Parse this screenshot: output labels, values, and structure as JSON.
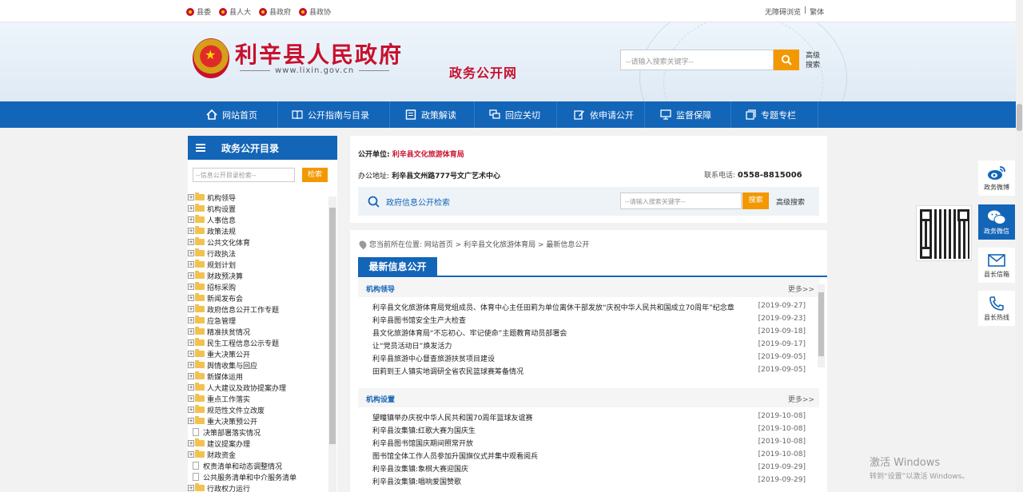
{
  "topbar": {
    "links": [
      "县委",
      "县人大",
      "县政府",
      "县政协"
    ],
    "accessibility": "无障碍浏览",
    "divider": "|",
    "traditional": "繁体"
  },
  "header": {
    "site_name": "利辛县人民政府",
    "site_url": "www.lixin.gov.cn",
    "sub_title": "政务公开网",
    "search_placeholder": "--请输入搜索关键字--",
    "advanced_search": "高级搜索"
  },
  "nav": {
    "items": [
      {
        "label": "网站首页",
        "icon": "home-icon"
      },
      {
        "label": "公开指南与目录",
        "icon": "book-icon"
      },
      {
        "label": "政策解读",
        "icon": "document-icon"
      },
      {
        "label": "回应关切",
        "icon": "chat-icon"
      },
      {
        "label": "依申请公开",
        "icon": "edit-icon"
      },
      {
        "label": "监督保障",
        "icon": "monitor-icon"
      },
      {
        "label": "专题专栏",
        "icon": "layers-icon"
      }
    ]
  },
  "sidebar": {
    "title": "政务公开目录",
    "search_placeholder": "--信息公开目录检索--",
    "search_button": "检索",
    "tree": [
      {
        "label": "机构领导",
        "type": "folder"
      },
      {
        "label": "机构设置",
        "type": "folder"
      },
      {
        "label": "人事信息",
        "type": "folder"
      },
      {
        "label": "政策法规",
        "type": "folder"
      },
      {
        "label": "公共文化体育",
        "type": "folder"
      },
      {
        "label": "行政执法",
        "type": "folder"
      },
      {
        "label": "规划计划",
        "type": "folder"
      },
      {
        "label": "财政预决算",
        "type": "folder"
      },
      {
        "label": "招标采购",
        "type": "folder"
      },
      {
        "label": "新闻发布会",
        "type": "folder"
      },
      {
        "label": "政府信息公开工作专题",
        "type": "folder"
      },
      {
        "label": "应急管理",
        "type": "folder"
      },
      {
        "label": "精准扶贫情况",
        "type": "folder"
      },
      {
        "label": "民生工程信息公示专题",
        "type": "folder"
      },
      {
        "label": "重大决策公开",
        "type": "folder"
      },
      {
        "label": "舆情收集与回应",
        "type": "folder"
      },
      {
        "label": "新媒体运用",
        "type": "folder"
      },
      {
        "label": "人大建议及政协提案办理",
        "type": "folder"
      },
      {
        "label": "重点工作落实",
        "type": "folder"
      },
      {
        "label": "规范性文件立改废",
        "type": "folder"
      },
      {
        "label": "重大决策预公开",
        "type": "folder"
      },
      {
        "label": "决策部署落实情况",
        "type": "doc"
      },
      {
        "label": "建议提案办理",
        "type": "folder"
      },
      {
        "label": "财政资金",
        "type": "folder"
      },
      {
        "label": "权责清单和动态调整情况",
        "type": "doc"
      },
      {
        "label": "公共服务清单和中介服务清单",
        "type": "doc"
      },
      {
        "label": "行政权力运行",
        "type": "folder"
      }
    ]
  },
  "infobox": {
    "unit_label": "公开单位:",
    "unit_value": "利辛县文化旅游体育局",
    "address_label": "办公地址:",
    "address_value": "利辛县文州路777号文广艺术中心",
    "tel_label": "联系电话:",
    "tel_value": "0558-8815006",
    "search_title": "政府信息公开检索",
    "search_placeholder": "--请输入搜索关键字--",
    "search_button": "搜索",
    "advanced": "高级搜索"
  },
  "main": {
    "breadcrumb": "您当前所在位置: 网站首页 > 利辛县文化旅游体育局 > 最新信息公开",
    "tab": "最新信息公开",
    "more": "更多>>",
    "sections": [
      {
        "title": "机构领导",
        "items": [
          {
            "text": "利辛县文化旅游体育局党组成员、体育中心主任田莉为单位离休干部发放“庆祝中华人民共和国成立70周年”纪念章",
            "date": "[2019-09-27]"
          },
          {
            "text": "利辛县图书馆安全生产大检查",
            "date": "[2019-09-23]"
          },
          {
            "text": "县文化旅游体育局“不忘初心、牢记使命”主题教育动员部署会",
            "date": "[2019-09-18]"
          },
          {
            "text": "让“党员活动日”焕发活力",
            "date": "[2019-09-17]"
          },
          {
            "text": "利辛县旅游中心督查旅游扶贫项目建设",
            "date": "[2019-09-05]"
          },
          {
            "text": "田莉到王人镇实地调研全省农民篮球赛筹备情况",
            "date": "[2019-09-05]"
          }
        ]
      },
      {
        "title": "机构设置",
        "items": [
          {
            "text": "望疃镇举办庆祝中华人民共和国70周年篮球友谊赛",
            "date": "[2019-10-08]"
          },
          {
            "text": "利辛县汝集镇:红歌大赛为国庆生",
            "date": "[2019-10-08]"
          },
          {
            "text": "利辛县图书馆国庆期间照常开放",
            "date": "[2019-10-08]"
          },
          {
            "text": "图书馆全体工作人员参加升国旗仪式并集中观看阅兵",
            "date": "[2019-10-08]"
          },
          {
            "text": "利辛县汝集镇:象棋大赛迎国庆",
            "date": "[2019-09-29]"
          },
          {
            "text": "利辛县汝集镇:唱响爱国赞歌",
            "date": "[2019-09-29]"
          }
        ]
      }
    ]
  },
  "float": {
    "items": [
      {
        "label": "政务微博",
        "icon": "weibo-icon"
      },
      {
        "label": "政务微信",
        "icon": "wechat-icon"
      },
      {
        "label": "县长信箱",
        "icon": "mail-icon"
      },
      {
        "label": "县长热线",
        "icon": "phone-icon"
      }
    ]
  },
  "watermark": {
    "line1": "激活 Windows",
    "line2": "转到“设置”以激活 Windows。"
  },
  "colors": {
    "primary": "#1365b8",
    "accent": "#f39800",
    "brand_red": "#c8102e"
  }
}
